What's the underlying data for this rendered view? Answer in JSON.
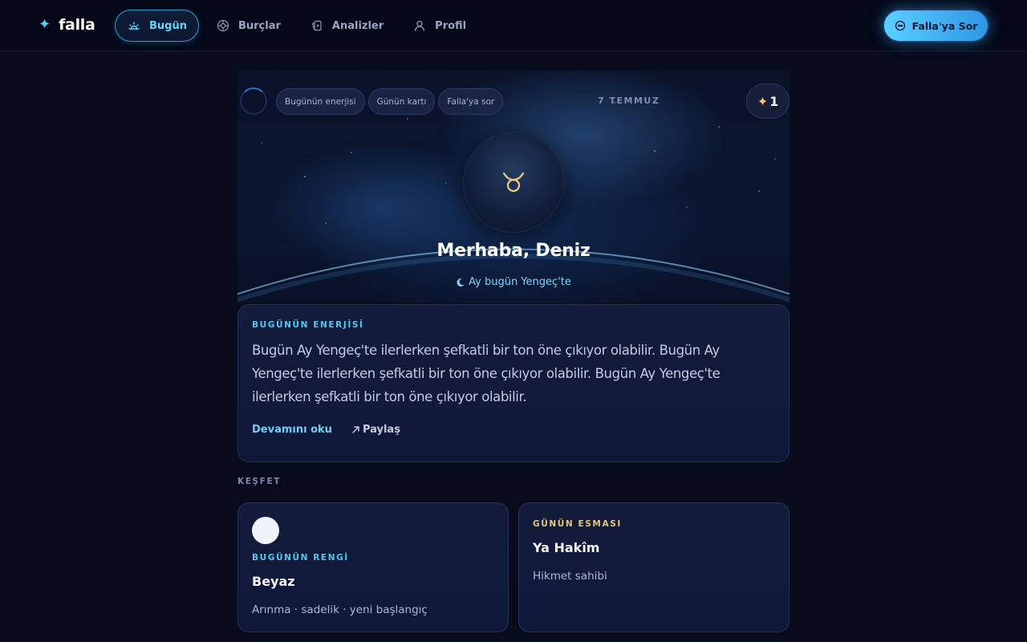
{
  "app": {
    "brand": "falla",
    "nav": [
      {
        "id": "bugun",
        "label": "Bugün",
        "icon": "sunrise-icon",
        "active": true
      },
      {
        "id": "burclar",
        "label": "Burçlar",
        "icon": "zodiac-wheel-icon",
        "active": false
      },
      {
        "id": "analizler",
        "label": "Analizler",
        "icon": "cards-icon",
        "active": false
      },
      {
        "id": "profil",
        "label": "Profil",
        "icon": "user-icon",
        "active": false
      }
    ],
    "ask_button": "Falla'ya Sor",
    "accent_color": "#4fd0f2"
  },
  "hero": {
    "chips": [
      "Bugünün enerjisi",
      "Günün kartı",
      "Falla'ya sor"
    ],
    "date": "7 TEMMUZ",
    "star_count": "1",
    "zodiac_symbol": "♉",
    "greeting": "Merhaba, Deniz",
    "moon_text": "Ay bugün Yengeç'te"
  },
  "energy": {
    "overline": "BUGÜNÜN ENERJİSİ",
    "text": "Bugün Ay Yengeç'te ilerlerken şefkatli bir ton öne çıkıyor olabilir. Bugün Ay Yengeç'te ilerlerken şefkatli bir ton öne çıkıyor olabilir. Bugün Ay Yengeç'te ilerlerken şefkatli bir ton öne çıkıyor olabilir.",
    "read_more": "Devamını oku",
    "share": "Paylaş"
  },
  "discover": {
    "label": "KEŞFET",
    "color_card": {
      "overline": "BUGÜNÜN RENGİ",
      "title": "Beyaz",
      "subtitle": "Arınma · sadelik · yeni başlangıç",
      "swatch_color": "#eef2fb"
    },
    "esma_card": {
      "overline": "GÜNÜN ESMASI",
      "title": "Ya Hakîm",
      "subtitle": "Hikmet sahibi"
    }
  }
}
